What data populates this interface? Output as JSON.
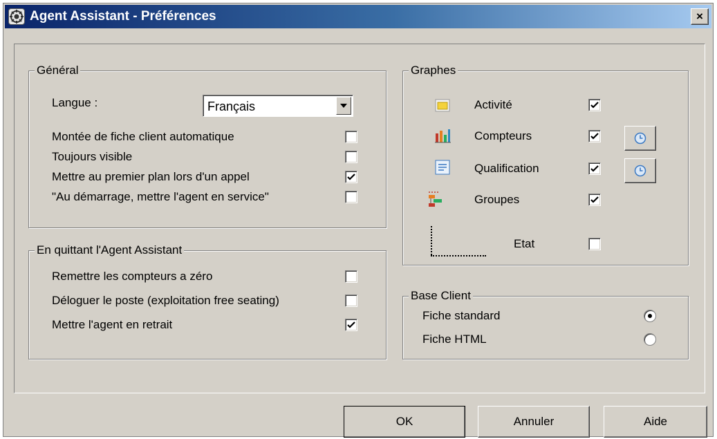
{
  "window": {
    "title": "Agent Assistant - Préférences",
    "close_label": "×"
  },
  "general": {
    "legend": "Général",
    "language_label": "Langue :",
    "language_value": "Français",
    "options": [
      {
        "label": "Montée de fiche client automatique",
        "checked": false
      },
      {
        "label": "Toujours visible",
        "checked": false
      },
      {
        "label": "Mettre au premier plan lors d'un appel",
        "checked": true
      },
      {
        "label": "\"Au démarrage, mettre l'agent en service\"",
        "checked": false
      }
    ]
  },
  "on_quit": {
    "legend": "En quittant l'Agent Assistant",
    "options": [
      {
        "label": "Remettre les compteurs a zéro",
        "checked": false
      },
      {
        "label": "Déloguer le poste  (exploitation free seating)",
        "checked": false
      },
      {
        "label": "Mettre l'agent en retrait",
        "checked": true
      }
    ]
  },
  "graphs": {
    "legend": "Graphes",
    "items": [
      {
        "label": "Activité",
        "icon": "activity-icon",
        "checked": true,
        "has_clock": false
      },
      {
        "label": "Compteurs",
        "icon": "bar-chart-icon",
        "checked": true,
        "has_clock": true
      },
      {
        "label": "Qualification",
        "icon": "form-icon",
        "checked": true,
        "has_clock": true
      },
      {
        "label": "Groupes",
        "icon": "groups-tree-icon",
        "checked": true,
        "has_clock": false
      }
    ],
    "sub_item": {
      "label": "Etat",
      "checked": false
    }
  },
  "base_client": {
    "legend": "Base Client",
    "options": [
      {
        "label": "Fiche standard",
        "selected": true
      },
      {
        "label": "Fiche HTML",
        "selected": false
      }
    ]
  },
  "buttons": {
    "ok": "OK",
    "cancel": "Annuler",
    "help": "Aide"
  },
  "colors": {
    "dialog_bg": "#d4d0c8",
    "title_gradient_start": "#0a246a",
    "title_gradient_end": "#a6caf0"
  }
}
